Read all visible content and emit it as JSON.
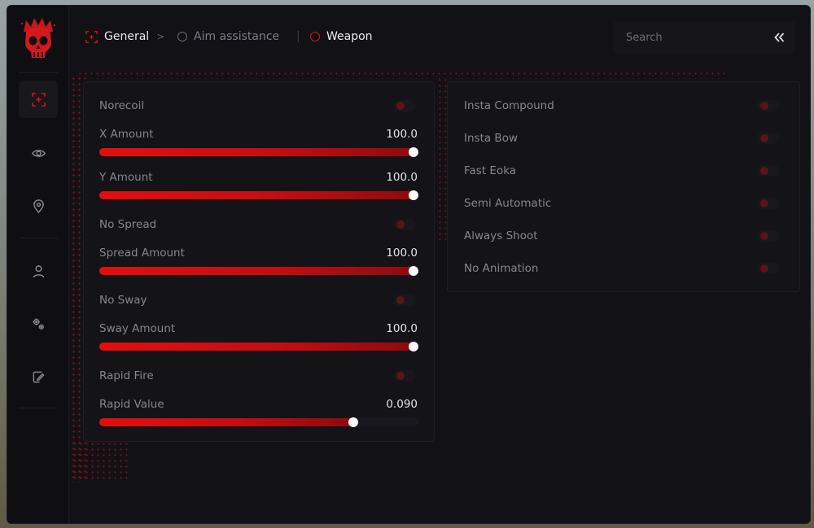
{
  "colors": {
    "accent": "#e01212",
    "bg": "#111116",
    "panel": "#131318"
  },
  "sidebar": {
    "logo": "crowned-skull-logo",
    "items": [
      {
        "icon": "crosshair-icon",
        "active": true
      },
      {
        "icon": "eye-icon",
        "active": false
      },
      {
        "icon": "location-pin-icon",
        "active": false
      },
      {
        "icon": "user-icon",
        "active": false
      },
      {
        "icon": "gears-icon",
        "active": false
      },
      {
        "icon": "edit-note-icon",
        "active": false
      }
    ]
  },
  "breadcrumb": {
    "general": "General",
    "arrow": ">",
    "aim": "Aim assistance",
    "divider": "|",
    "weapon": "Weapon"
  },
  "search": {
    "placeholder": "Search",
    "value": ""
  },
  "left_panel": {
    "norecoil": {
      "label": "Norecoil",
      "enabled": false
    },
    "x_amount": {
      "label": "X Amount",
      "value": "100.0",
      "fraction": 1.0
    },
    "y_amount": {
      "label": "Y Amount",
      "value": "100.0",
      "fraction": 1.0
    },
    "no_spread": {
      "label": "No Spread",
      "enabled": false
    },
    "spread_amount": {
      "label": "Spread Amount",
      "value": "100.0",
      "fraction": 1.0
    },
    "no_sway": {
      "label": "No Sway",
      "enabled": false
    },
    "sway_amount": {
      "label": "Sway Amount",
      "value": "100.0",
      "fraction": 1.0
    },
    "rapid_fire": {
      "label": "Rapid Fire",
      "enabled": false
    },
    "rapid_value": {
      "label": "Rapid Value",
      "value": "0.090",
      "fraction": 0.795
    }
  },
  "right_panel": {
    "items": [
      {
        "label": "Insta Compound",
        "enabled": false
      },
      {
        "label": "Insta Bow",
        "enabled": false
      },
      {
        "label": "Fast Eoka",
        "enabled": false
      },
      {
        "label": "Semi Automatic",
        "enabled": false
      },
      {
        "label": "Always Shoot",
        "enabled": false
      },
      {
        "label": "No Animation",
        "enabled": false
      }
    ]
  }
}
